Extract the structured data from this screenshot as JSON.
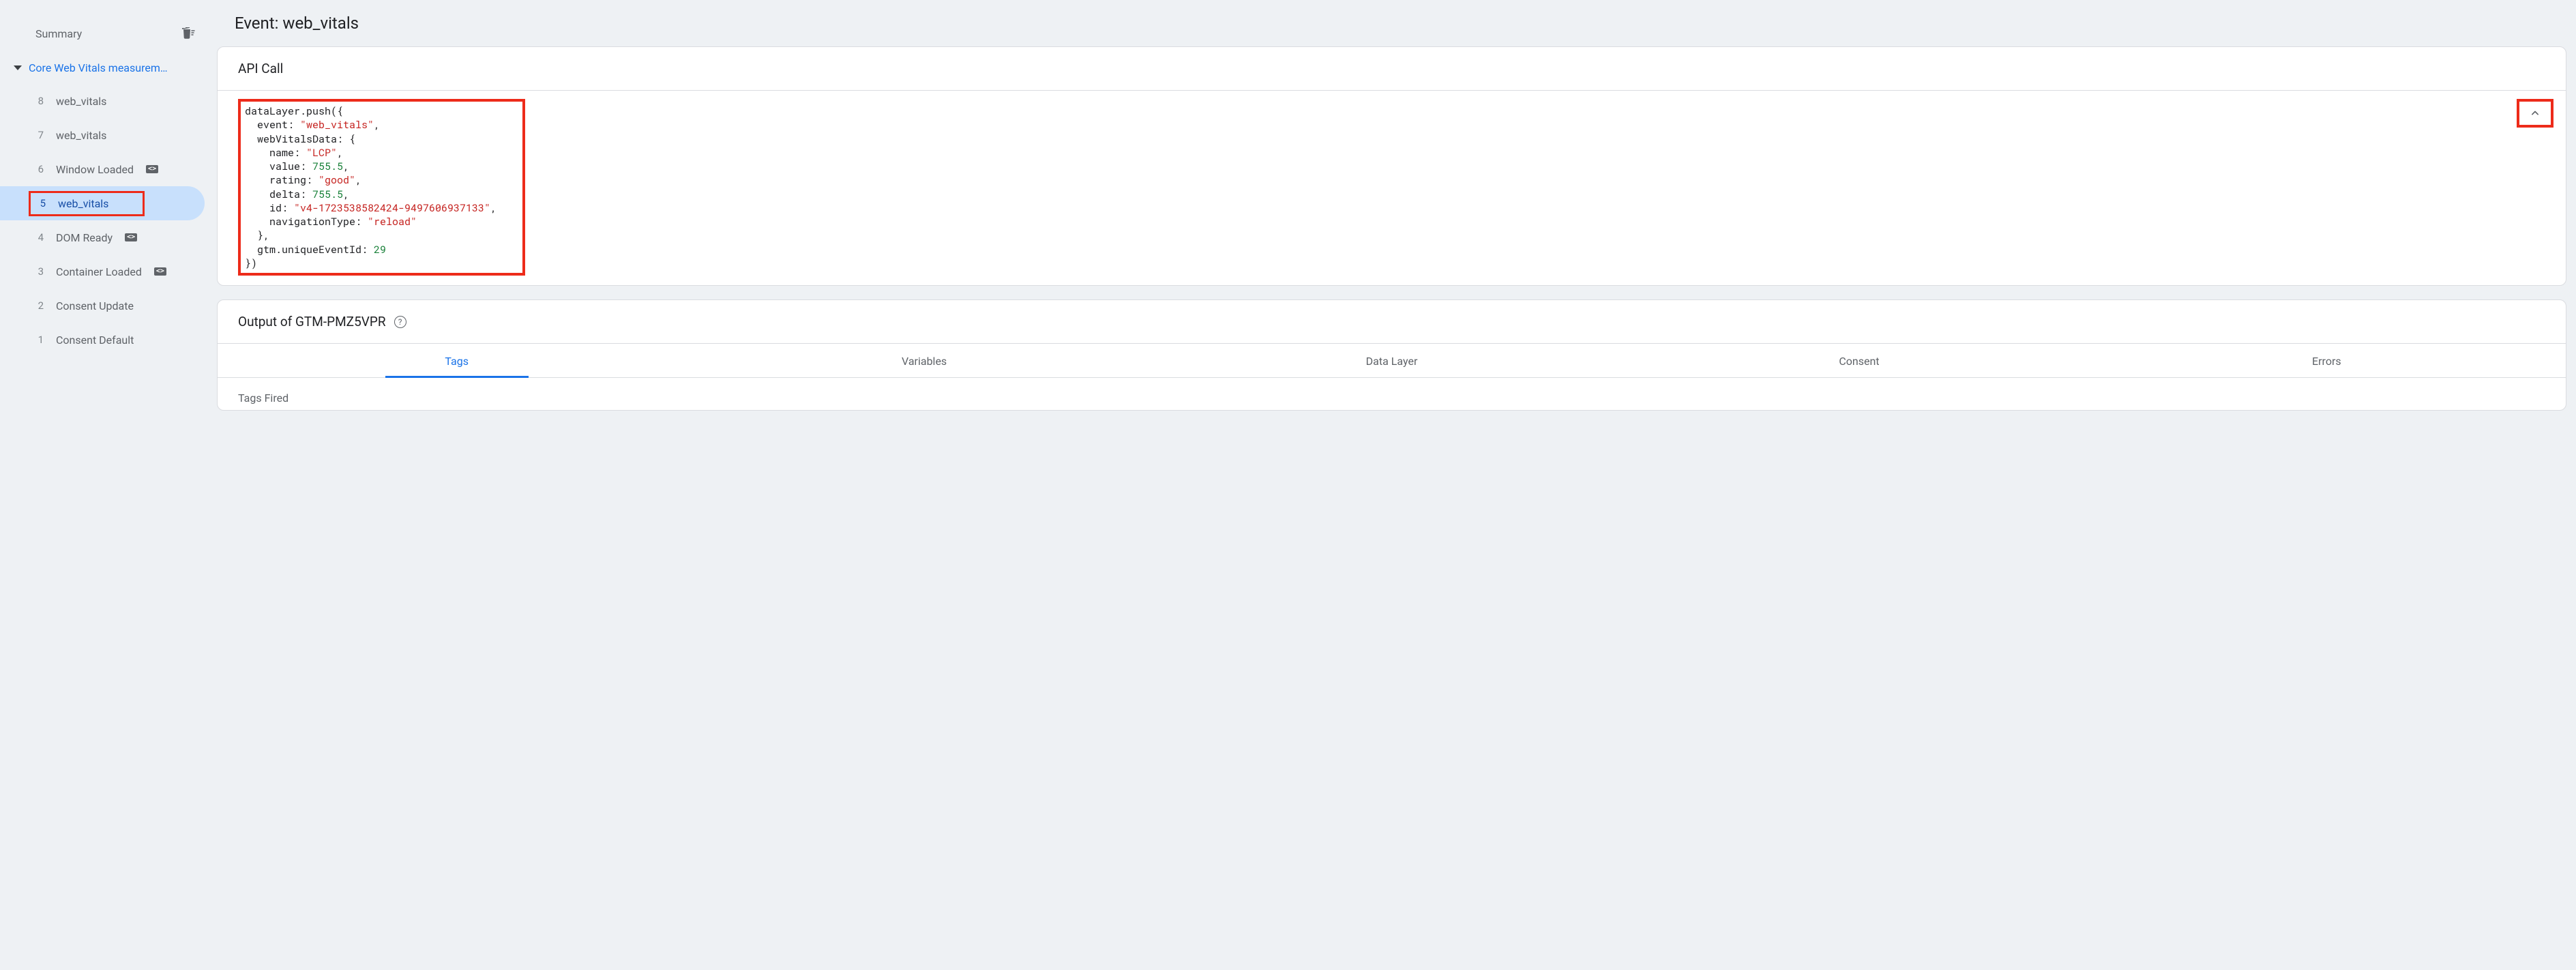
{
  "sidebar": {
    "summary_label": "Summary",
    "group_title": "Core Web Vitals measurem…",
    "items": [
      {
        "num": "8",
        "label": "web_vitals",
        "badge": false
      },
      {
        "num": "7",
        "label": "web_vitals",
        "badge": false
      },
      {
        "num": "6",
        "label": "Window Loaded",
        "badge": true
      },
      {
        "num": "5",
        "label": "web_vitals",
        "badge": false,
        "selected": true,
        "highlighted": true
      },
      {
        "num": "4",
        "label": "DOM Ready",
        "badge": true
      },
      {
        "num": "3",
        "label": "Container Loaded",
        "badge": true
      },
      {
        "num": "2",
        "label": "Consent Update",
        "badge": false
      },
      {
        "num": "1",
        "label": "Consent Default",
        "badge": false
      }
    ]
  },
  "main": {
    "page_title": "Event: web_vitals",
    "api_call": {
      "title": "API Call",
      "code": {
        "fn": "dataLayer.push",
        "event": "web_vitals",
        "webVitalsData": {
          "name": "LCP",
          "value": 755.5,
          "rating": "good",
          "delta": 755.5,
          "id": "v4-1723538582424-9497606937133",
          "navigationType": "reload"
        },
        "uniqueEventId": 29
      }
    },
    "output": {
      "title": "Output of GTM-PMZ5VPR",
      "tabs": [
        "Tags",
        "Variables",
        "Data Layer",
        "Consent",
        "Errors"
      ],
      "active_tab": 0,
      "section_label": "Tags Fired"
    }
  }
}
